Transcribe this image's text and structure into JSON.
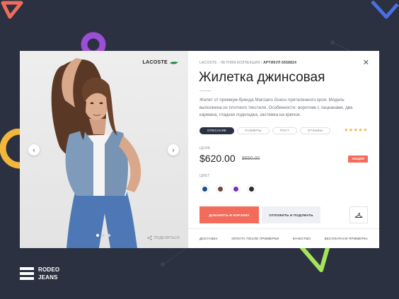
{
  "background": "#2b3140",
  "accent": "#f36c5b",
  "brand": {
    "logo": "LACOSTE",
    "logo_icon": "crocodile-icon"
  },
  "breadcrumb": {
    "brand": "LACOSTE",
    "collection": " - ЛЕТНЯЯ КОЛЛЕКЦИЯ / ",
    "article": "АРТИКУЛ 6658824"
  },
  "product": {
    "title": "Жилетка джинсовая",
    "description": "Жилет от премиум-бренда Marciano Guess приталенного кроя. Модель выполнена из плотного текстиля. Особенности: воротник с лацканами, два кармана, гладкая подкладка, застежка на крючок.",
    "rating": 5,
    "stars": "★★★★★",
    "price_label": "ЦЕНА",
    "price": "$620.00",
    "old_price": "$650.00",
    "sale_badge": "АКЦИЯ",
    "color_label": "ЦВЕТ",
    "colors": [
      "#1f4e8c",
      "#6b4a3a",
      "#7b2fbe",
      "#2c2c2c"
    ]
  },
  "tabs": [
    {
      "label": "ОПИСАНИЕ",
      "active": true
    },
    {
      "label": "РАЗМЕРЫ",
      "active": false
    },
    {
      "label": "РОСТ",
      "active": false
    },
    {
      "label": "ОТЗЫВЫ",
      "active": false
    }
  ],
  "buttons": {
    "add_to_cart": "ДОБАВИТЬ В КОРЗИНУ",
    "save_later": "ОТЛОЖИТЬ И ПОДУМАТЬ",
    "close": "✕",
    "hanger_icon": "hanger-icon"
  },
  "gallery": {
    "share": "ПОДЕЛИТЬСЯ",
    "prev": "‹",
    "next": "›",
    "slides": 3,
    "active_slide": 1
  },
  "footer": [
    "ДОСТАВКА",
    "ОПЛАТА ПОСЛЕ ПРИМЕРКИ",
    "КАЧЕСТВО",
    "БЕСПЛАТНАЯ ПРИМЕРКА"
  ],
  "store_logo": {
    "line1": "RODEO",
    "line2": "JEANS"
  }
}
